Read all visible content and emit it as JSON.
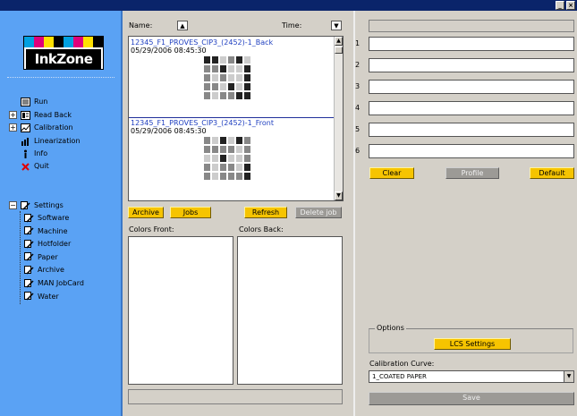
{
  "window": {
    "minimize_glyph": "_",
    "close_glyph": "×"
  },
  "sidebar": {
    "logo_text": "InkZone",
    "logo_colors": [
      "#00a0e0",
      "#e0007a",
      "#ffe000",
      "#000000",
      "#00a0e0",
      "#e0007a",
      "#ffe000",
      "#000000"
    ],
    "items": [
      {
        "label": "Run",
        "icon": "run-icon"
      },
      {
        "label": "Read Back",
        "icon": "read-back-icon"
      },
      {
        "label": "Calibration",
        "icon": "calibration-icon"
      },
      {
        "label": "Linearization",
        "icon": "linearization-icon"
      },
      {
        "label": "Info",
        "icon": "info-icon"
      },
      {
        "label": "Quit",
        "icon": "quit-icon"
      }
    ],
    "settings": {
      "label": "Settings",
      "children": [
        "Software",
        "Machine",
        "Hotfolder",
        "Paper",
        "Archive",
        "MAN JobCard",
        "Water"
      ]
    }
  },
  "jobs": {
    "name_label": "Name:",
    "time_label": "Time:",
    "sort_up_glyph": "▲",
    "sort_down_glyph": "▼",
    "list": [
      {
        "name": "12345_F1_PROVES_CIP3_(2452)-1_Back",
        "date": "05/29/2006 08:45:30"
      },
      {
        "name": "12345_F1_PROVES_CIP3_(2452)-1_Front",
        "date": "05/29/2006 08:45:30"
      }
    ],
    "buttons": {
      "archive": "Archive",
      "jobs": "Jobs",
      "refresh": "Refresh",
      "delete_job": "Delete job"
    },
    "colors_front_label": "Colors Front:",
    "colors_back_label": "Colors Back:"
  },
  "profile": {
    "field_numbers": [
      "1",
      "2",
      "3",
      "4",
      "5",
      "6"
    ],
    "buttons": {
      "clear": "Clear",
      "profile": "Profile",
      "default": "Default"
    },
    "options_label": "Options",
    "lcs_settings": "LCS Settings",
    "calibration_curve_label": "Calibration Curve:",
    "calibration_curve_value": "1_COATED PAPER",
    "save": "Save"
  },
  "colors": {
    "sidebar": "#5aa2f4",
    "button_active": "#f6c400",
    "button_disabled": "#9c9a96",
    "job_name": "#2040c0"
  }
}
